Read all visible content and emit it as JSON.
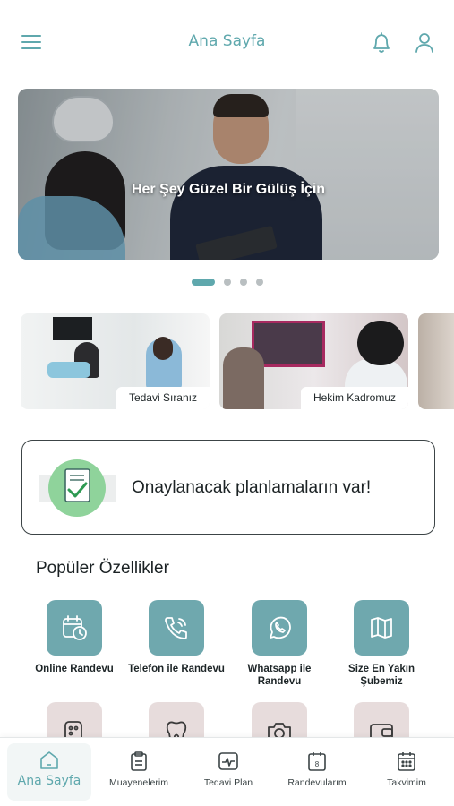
{
  "header": {
    "title": "Ana Sayfa",
    "icons": [
      "menu-icon",
      "bell-icon",
      "user-icon"
    ]
  },
  "hero": {
    "caption": "Her Şey Güzel Bir Gülüş İçin",
    "slide_count": 4,
    "active_slide": 1
  },
  "categories": [
    {
      "label": "Tedavi Sıranız"
    },
    {
      "label": "Hekim Kadromuz"
    },
    {
      "label": ""
    }
  ],
  "pending_plans": {
    "text": "Onaylanacak planlamaların var!",
    "icon": "document-check-icon"
  },
  "popular": {
    "title": "Popüler Özellikler",
    "items": [
      {
        "label": "Online Randevu",
        "icon": "calendar-clock-icon"
      },
      {
        "label": "Telefon ile Randevu",
        "icon": "phone-call-icon"
      },
      {
        "label": "Whatsapp ile Randevu",
        "icon": "whatsapp-icon"
      },
      {
        "label": "Size En Yakın Şubemiz",
        "icon": "map-icon"
      },
      {
        "label": "",
        "icon": "pills-icon"
      },
      {
        "label": "",
        "icon": "tooth-icon"
      },
      {
        "label": "",
        "icon": "camera-icon"
      },
      {
        "label": "",
        "icon": "wallet-icon"
      }
    ]
  },
  "bottom_nav": {
    "items": [
      {
        "label": "Ana Sayfa",
        "icon": "home-icon",
        "active": true
      },
      {
        "label": "Muayenelerim",
        "icon": "clipboard-icon",
        "active": false
      },
      {
        "label": "Tedavi Plan",
        "icon": "heart-monitor-icon",
        "active": false
      },
      {
        "label": "Randevularım",
        "icon": "calendar-day-icon",
        "active": false
      },
      {
        "label": "Takvimim",
        "icon": "calendar-grid-icon",
        "active": false
      }
    ],
    "calendar_badge": "8"
  },
  "colors": {
    "accent": "#5fa8ad",
    "tile": "#6fa8ae",
    "tile_muted": "#e7dcdc",
    "text": "#1b2224"
  }
}
